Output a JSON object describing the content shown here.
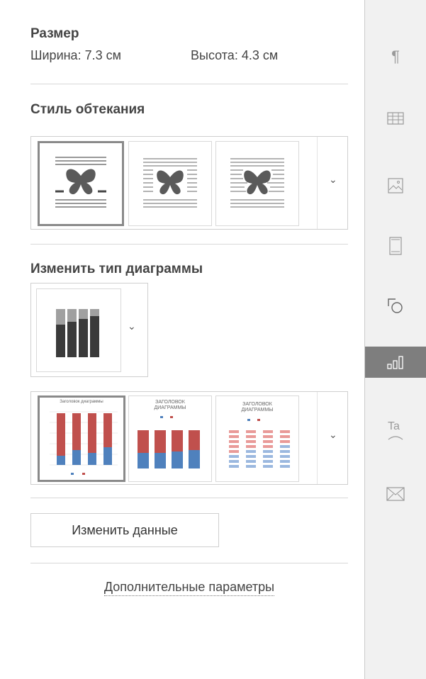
{
  "size": {
    "title": "Размер",
    "width_label": "Ширина: 7.3 см",
    "height_label": "Высота: 4.3 см"
  },
  "wrap": {
    "title": "Стиль обтекания",
    "options": [
      "inline",
      "square",
      "tight"
    ],
    "selected": 0
  },
  "chart_type": {
    "title": "Изменить тип диаграммы",
    "selected_icon": "stacked-column-chart-icon",
    "styles": [
      {
        "title": "Заголовок диаграммы",
        "selected": true
      },
      {
        "title": "ЗАГОЛОВОК ДИАГРАММЫ",
        "selected": false
      },
      {
        "title": "ЗАГОЛОВОК ДИАГРАММЫ",
        "selected": false
      }
    ]
  },
  "actions": {
    "edit_data": "Изменить данные",
    "advanced": "Дополнительные параметры"
  },
  "sidebar": {
    "icons": [
      "paragraph-icon",
      "table-icon",
      "image-icon",
      "header-footer-icon",
      "shape-icon",
      "chart-icon",
      "textart-icon",
      "mail-merge-icon"
    ],
    "active": "chart-icon"
  },
  "colors": {
    "accent_active": "#7e7e7e",
    "series_red": "#c0504d",
    "series_blue": "#4f81bd"
  }
}
